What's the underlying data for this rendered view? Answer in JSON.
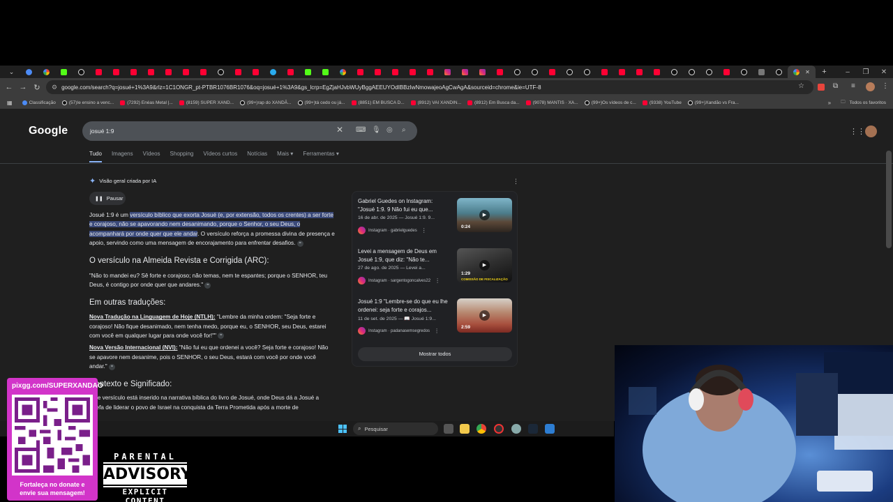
{
  "tabs": [
    {
      "icon": "bl"
    },
    {
      "icon": "gg"
    },
    {
      "icon": "kk"
    },
    {
      "icon": "tk"
    },
    {
      "icon": "yt"
    },
    {
      "icon": "yt"
    },
    {
      "icon": "yt"
    },
    {
      "icon": "yt"
    },
    {
      "icon": "yt"
    },
    {
      "icon": "yt"
    },
    {
      "icon": "yt"
    },
    {
      "icon": "tk"
    },
    {
      "icon": "yt"
    },
    {
      "icon": "yt"
    },
    {
      "icon": "tg"
    },
    {
      "icon": "yt"
    },
    {
      "icon": "kk"
    },
    {
      "icon": "kk"
    },
    {
      "icon": "gg"
    },
    {
      "icon": "yt"
    },
    {
      "icon": "yt"
    },
    {
      "icon": "yt"
    },
    {
      "icon": "yt"
    },
    {
      "icon": "yt"
    },
    {
      "icon": "ig"
    },
    {
      "icon": "ig"
    },
    {
      "icon": "ig"
    },
    {
      "icon": "yt"
    },
    {
      "icon": "tk"
    },
    {
      "icon": "tk"
    },
    {
      "icon": "yt"
    },
    {
      "icon": "tk"
    },
    {
      "icon": "tk"
    },
    {
      "icon": "yt"
    },
    {
      "icon": "yt"
    },
    {
      "icon": "yt"
    },
    {
      "icon": "yt"
    },
    {
      "icon": "tk"
    },
    {
      "icon": "tk"
    },
    {
      "icon": "tk"
    },
    {
      "icon": "yt"
    },
    {
      "icon": "tk"
    },
    {
      "icon": "gr"
    },
    {
      "icon": "tk"
    }
  ],
  "url": "google.com/search?q=josué+1%3A9&rlz=1C1ONGR_pt-PTBR1076BR1076&oq=josué+1%3A9&gs_lcrp=EgZjaHJvbWUyBggAEEUYOdIBBzIwNmowajeoAgCwAgA&sourceid=chrome&ie=UTF-8",
  "bookmarks": [
    {
      "icon": "bl",
      "label": "Classificação"
    },
    {
      "icon": "tk",
      "label": "(57)Ie ensino a venc..."
    },
    {
      "icon": "yt",
      "label": "(7292) Enéas Metal |..."
    },
    {
      "icon": "yt",
      "label": "(8159) SUPER XAND..."
    },
    {
      "icon": "tk",
      "label": "(99+)rap do XANDÃ..."
    },
    {
      "icon": "tk",
      "label": "(99+)tá cedo ou já..."
    },
    {
      "icon": "yt",
      "label": "(8851) EM BUSCA D..."
    },
    {
      "icon": "yt",
      "label": "(8912) VAI XANDIN..."
    },
    {
      "icon": "yt",
      "label": "(8912) Em Busca da..."
    },
    {
      "icon": "yt",
      "label": "(9078) MANTIS · XA..."
    },
    {
      "icon": "tk",
      "label": "(99+)Os vídeos de c..."
    },
    {
      "icon": "yt",
      "label": "(9338) YouTube"
    },
    {
      "icon": "tk",
      "label": "(99+)Xandão vs Fra..."
    }
  ],
  "favorites_label": "Todos os favoritos",
  "google": {
    "logo": "Google",
    "query": "josué 1:9",
    "nav": [
      "Tudo",
      "Imagens",
      "Vídeos",
      "Shopping",
      "Vídeos curtos",
      "Notícias",
      "Mais ▾",
      "Ferramentas ▾"
    ]
  },
  "ai": {
    "header": "Visão geral criada por IA",
    "pause": "Pausar",
    "intro_pre": "Josué 1:9 é um ",
    "intro_hl": "versículo bíblico que exorta Josué (e, por extensão, todos os crentes) a ser forte e corajoso, não se apavorando nem desanimando, porque o Senhor, o seu Deus, o acompanhará por onde quer que ele andar",
    "intro_post": ". O versículo reforça a promessa divina de presença e apoio, servindo como uma mensagem de encorajamento para enfrentar desafios.",
    "h_arc": "O versículo na Almeida Revista e Corrigida (ARC):",
    "arc_text": "\"Não to mandei eu? Sê forte e corajoso; não temas, nem te espantes; porque o SENHOR, teu Deus, é contigo por onde quer que andares.\"",
    "h_outras": "Em outras traduções:",
    "ntlh_label": "Nova Tradução na Linguagem de Hoje (NTLH):",
    "ntlh_text": " \"Lembre da minha ordem: \"Seja forte e corajoso! Não fique desanimado, nem tenha medo, porque eu, o SENHOR, seu Deus, estarei com você em qualquer lugar para onde você for!\"\"",
    "nvi_label": "Nova Versão Internacional (NVI):",
    "nvi_text": " \"Não fui eu que ordenei a você? Seja forte e corajoso! Não se apavore nem desanime, pois o SENHOR, o seu Deus, estará com você por onde você andar.\"",
    "h_contexto": "Contexto e Significado:",
    "contexto_text": "Este versículo está inserido na narrativa bíblica do livro de Josué, onde Deus dá a Josué a tarefa de liderar o povo de Israel na conquista da Terra Prometida após a morte de"
  },
  "videos": [
    {
      "title": "Gabriel Guedes on Instagram: \"Josué 1:9. 9 Não fui eu que...",
      "date": "16 de abr. de 2025 — Josué 1:9. 9...",
      "source": "Instagram · gabrielguedes",
      "duration": "0:24"
    },
    {
      "title": "Levei a mensagem de Deus em Josué 1:9, que diz: \"Não te...",
      "date": "27 de ago. de 2025 — Levei a...",
      "source": "Instagram · sargentogoncalves22",
      "duration": "1:29"
    },
    {
      "title": "Josué 1:9 \"Lembre-se do que eu lhe ordenei: seja forte e corajos...",
      "date": "11 de set. de 2025 — 📖 Josué 1:9...",
      "source": "Instagram · padanasemsegredos",
      "duration": "2:59"
    }
  ],
  "thumb_caption": "COMISSÃO DE FISCALIZAÇÃO",
  "show_all": "Mostrar todos",
  "taskbar": {
    "search_placeholder": "Pesquisar"
  },
  "overlay": {
    "qr_url": "pixgg.com/SUPERXANDAO",
    "qr_msg_1": "Fortaleça no donate e",
    "qr_msg_2": "envie sua mensagem!",
    "pa_1": "PARENTAL",
    "pa_2": "ADVISORY",
    "pa_3": "EXPLICIT CONTENT"
  }
}
